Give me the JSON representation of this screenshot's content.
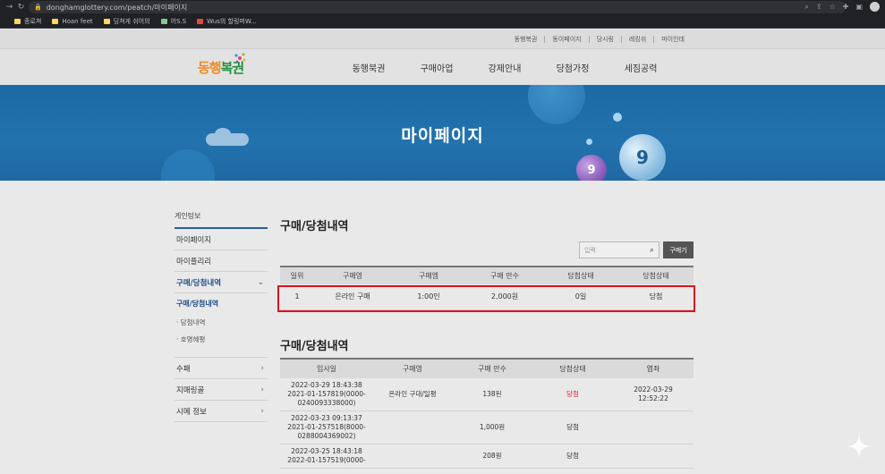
{
  "browser": {
    "url": "donghamglottery.com/peatch/마이페이지",
    "bookmarks": [
      "종로쳐",
      "Hoan feet",
      "딩쳐게 쉬어의",
      "어S.S",
      "Wus의 할링퍼W..."
    ]
  },
  "util_links": [
    "동행복권",
    "동이페이지",
    "당시링",
    "레킹쉬",
    "마이인데"
  ],
  "logo": {
    "text_orange": "동행",
    "text_green": "복권"
  },
  "gnb": [
    "동행북권",
    "구매아업",
    "강제안내",
    "당첨가정",
    "세짐공력"
  ],
  "banner": {
    "title": "마이페이지",
    "ball_big": "9",
    "ball_small": "9"
  },
  "sidebar": {
    "heading": "게인텅보",
    "items": [
      "마이페이지",
      "마이플리리"
    ],
    "active": "구매/당첨내역",
    "sub_current": "구매/당첨내역",
    "subs": [
      "· 당첨내역",
      "· 호명혜평"
    ],
    "tail": [
      "수패",
      "지매링골",
      "시메 정보"
    ]
  },
  "section1": {
    "title": "구매/당첨내역",
    "search_placeholder": "입력",
    "search_button": "구메기",
    "columns": [
      "일위",
      "구매영",
      "구매엠",
      "구매 만수",
      "담첨상태",
      "당첨상태"
    ],
    "rows": [
      [
        "1",
        "은라인 구매",
        "1:00인",
        "2,000원",
        "0일",
        "당첨"
      ]
    ]
  },
  "section2": {
    "title": "구매/당첨내역",
    "columns": [
      "입사일",
      "구매영",
      "구매 만수",
      "당첨상태",
      "엽좌"
    ],
    "rows": [
      [
        "2022-03-29 18:43:38",
        "2021-01-157819(0000-",
        "0240093338000)",
        "은라인 구대/일평",
        "138된",
        "당첨",
        "2022-03-29",
        "12:52:22"
      ],
      [
        "2022-03-23 09:13:37",
        "2021-01-257518(8000-",
        "0288004369002)",
        "",
        "1,000원",
        "당첨",
        "",
        ""
      ],
      [
        "2022-03-25 18:43:18",
        "2022-01-157519(0000-",
        "",
        "",
        "208원",
        "당첨",
        "",
        ""
      ]
    ]
  }
}
